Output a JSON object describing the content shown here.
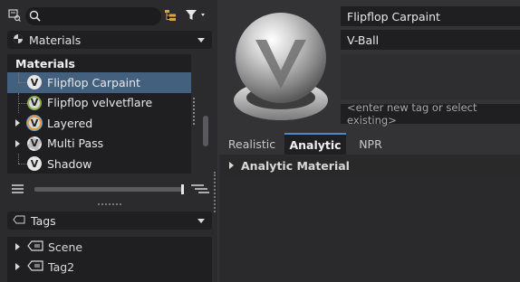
{
  "search": {
    "placeholder": ""
  },
  "icons": {
    "window_icon": "window-pin-icon",
    "search": "search-icon",
    "hierarchy": "hierarchy-icon",
    "filter": "filter-icon"
  },
  "materials_dropdown": {
    "label": "Materials"
  },
  "tree": {
    "header": "Materials",
    "items": [
      {
        "label": "Flipflop Carpaint",
        "icon": "v-ball-material-icon",
        "selected": true,
        "expandable": false
      },
      {
        "label": "Flipflop velvetflare",
        "icon": "v-ball-material-icon",
        "selected": false,
        "expandable": false
      },
      {
        "label": "Layered",
        "icon": "layered-material-icon",
        "selected": false,
        "expandable": true
      },
      {
        "label": "Multi Pass",
        "icon": "multi-pass-material-icon",
        "selected": false,
        "expandable": true
      },
      {
        "label": "Shadow",
        "icon": "v-ball-material-icon",
        "selected": false,
        "expandable": false
      }
    ]
  },
  "tags_dropdown": {
    "label": "Tags"
  },
  "tags": {
    "items": [
      {
        "label": "Scene"
      },
      {
        "label": "Tag2"
      }
    ]
  },
  "material": {
    "name": "Flipflop Carpaint",
    "preview_shape": "V-Ball",
    "tag_placeholder": "<enter new tag or select existing>"
  },
  "tabs": [
    {
      "label": "Realistic",
      "active": false
    },
    {
      "label": "Analytic",
      "active": true
    },
    {
      "label": "NPR",
      "active": false
    }
  ],
  "section": {
    "label": "Analytic Material"
  },
  "colors": {
    "selection": "#44607f",
    "accent": "#4f86c6",
    "toolbar_orange": "#e0a03a"
  }
}
